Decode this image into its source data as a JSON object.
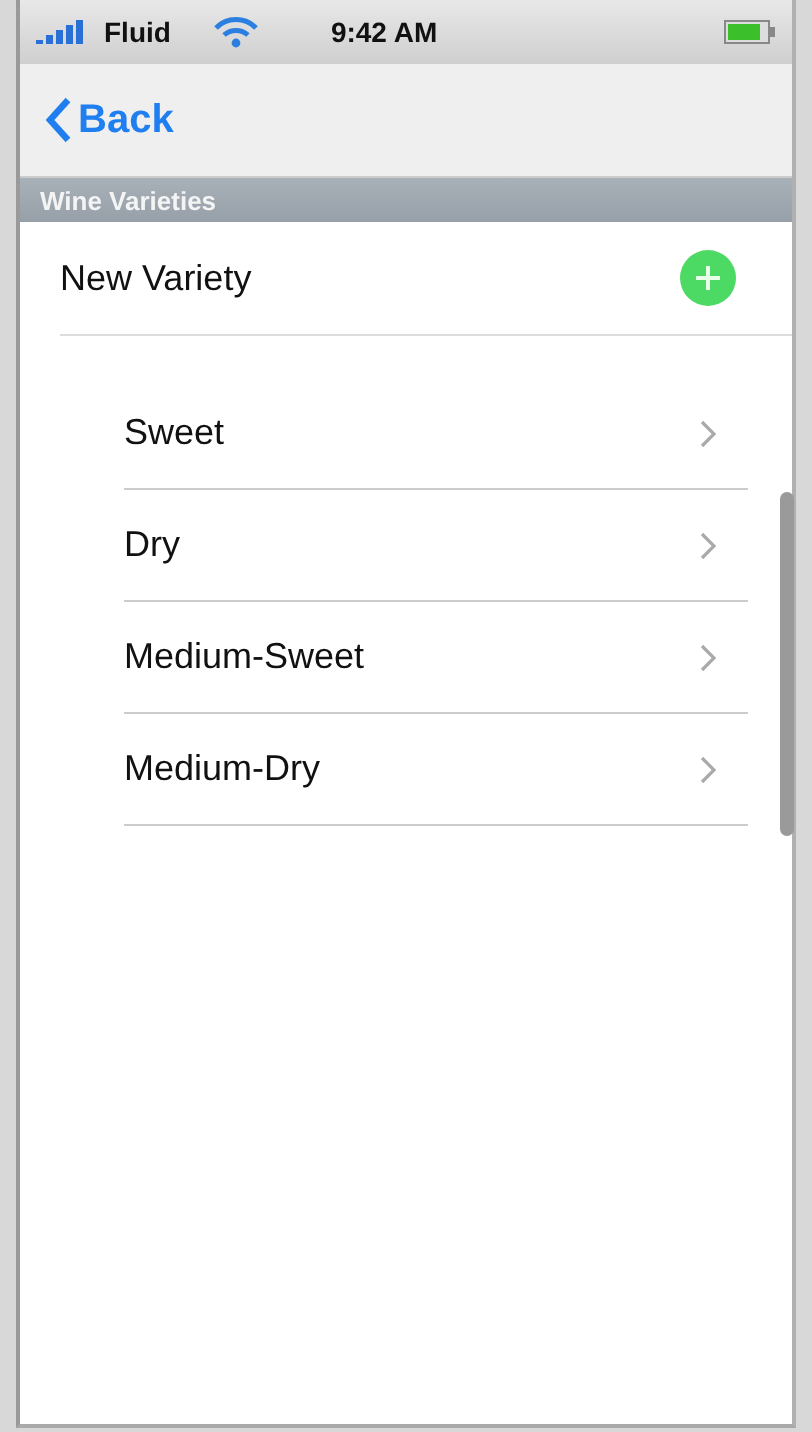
{
  "status_bar": {
    "carrier": "Fluid",
    "time": "9:42 AM"
  },
  "nav_bar": {
    "back": "Back"
  },
  "section": {
    "title": "Wine Varieties"
  },
  "new_row": {
    "label": "New Variety"
  },
  "varieties": [
    {
      "label": "Sweet"
    },
    {
      "label": "Dry"
    },
    {
      "label": "Medium-Sweet"
    },
    {
      "label": "Medium-Dry"
    }
  ]
}
